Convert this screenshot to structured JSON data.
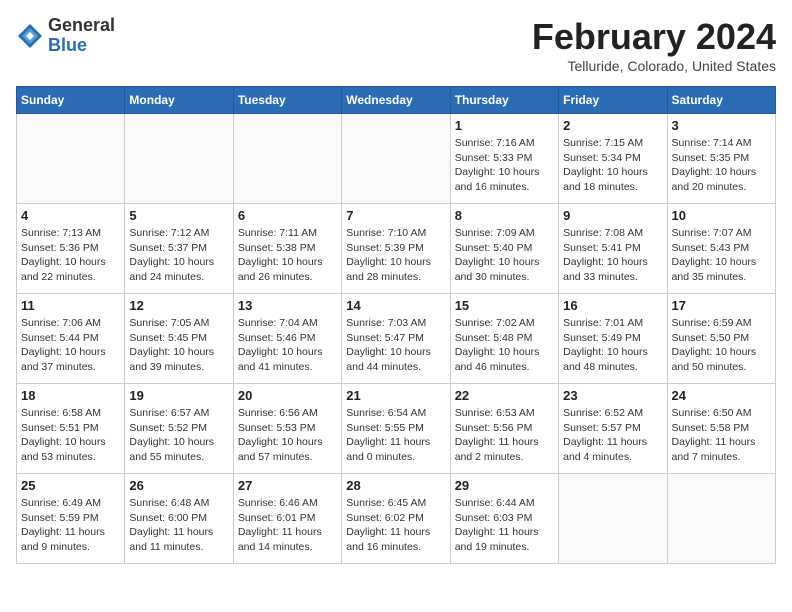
{
  "header": {
    "logo_general": "General",
    "logo_blue": "Blue",
    "title": "February 2024",
    "subtitle": "Telluride, Colorado, United States"
  },
  "days_of_week": [
    "Sunday",
    "Monday",
    "Tuesday",
    "Wednesday",
    "Thursday",
    "Friday",
    "Saturday"
  ],
  "weeks": [
    [
      {
        "day": "",
        "info": ""
      },
      {
        "day": "",
        "info": ""
      },
      {
        "day": "",
        "info": ""
      },
      {
        "day": "",
        "info": ""
      },
      {
        "day": "1",
        "info": "Sunrise: 7:16 AM\nSunset: 5:33 PM\nDaylight: 10 hours\nand 16 minutes."
      },
      {
        "day": "2",
        "info": "Sunrise: 7:15 AM\nSunset: 5:34 PM\nDaylight: 10 hours\nand 18 minutes."
      },
      {
        "day": "3",
        "info": "Sunrise: 7:14 AM\nSunset: 5:35 PM\nDaylight: 10 hours\nand 20 minutes."
      }
    ],
    [
      {
        "day": "4",
        "info": "Sunrise: 7:13 AM\nSunset: 5:36 PM\nDaylight: 10 hours\nand 22 minutes."
      },
      {
        "day": "5",
        "info": "Sunrise: 7:12 AM\nSunset: 5:37 PM\nDaylight: 10 hours\nand 24 minutes."
      },
      {
        "day": "6",
        "info": "Sunrise: 7:11 AM\nSunset: 5:38 PM\nDaylight: 10 hours\nand 26 minutes."
      },
      {
        "day": "7",
        "info": "Sunrise: 7:10 AM\nSunset: 5:39 PM\nDaylight: 10 hours\nand 28 minutes."
      },
      {
        "day": "8",
        "info": "Sunrise: 7:09 AM\nSunset: 5:40 PM\nDaylight: 10 hours\nand 30 minutes."
      },
      {
        "day": "9",
        "info": "Sunrise: 7:08 AM\nSunset: 5:41 PM\nDaylight: 10 hours\nand 33 minutes."
      },
      {
        "day": "10",
        "info": "Sunrise: 7:07 AM\nSunset: 5:43 PM\nDaylight: 10 hours\nand 35 minutes."
      }
    ],
    [
      {
        "day": "11",
        "info": "Sunrise: 7:06 AM\nSunset: 5:44 PM\nDaylight: 10 hours\nand 37 minutes."
      },
      {
        "day": "12",
        "info": "Sunrise: 7:05 AM\nSunset: 5:45 PM\nDaylight: 10 hours\nand 39 minutes."
      },
      {
        "day": "13",
        "info": "Sunrise: 7:04 AM\nSunset: 5:46 PM\nDaylight: 10 hours\nand 41 minutes."
      },
      {
        "day": "14",
        "info": "Sunrise: 7:03 AM\nSunset: 5:47 PM\nDaylight: 10 hours\nand 44 minutes."
      },
      {
        "day": "15",
        "info": "Sunrise: 7:02 AM\nSunset: 5:48 PM\nDaylight: 10 hours\nand 46 minutes."
      },
      {
        "day": "16",
        "info": "Sunrise: 7:01 AM\nSunset: 5:49 PM\nDaylight: 10 hours\nand 48 minutes."
      },
      {
        "day": "17",
        "info": "Sunrise: 6:59 AM\nSunset: 5:50 PM\nDaylight: 10 hours\nand 50 minutes."
      }
    ],
    [
      {
        "day": "18",
        "info": "Sunrise: 6:58 AM\nSunset: 5:51 PM\nDaylight: 10 hours\nand 53 minutes."
      },
      {
        "day": "19",
        "info": "Sunrise: 6:57 AM\nSunset: 5:52 PM\nDaylight: 10 hours\nand 55 minutes."
      },
      {
        "day": "20",
        "info": "Sunrise: 6:56 AM\nSunset: 5:53 PM\nDaylight: 10 hours\nand 57 minutes."
      },
      {
        "day": "21",
        "info": "Sunrise: 6:54 AM\nSunset: 5:55 PM\nDaylight: 11 hours\nand 0 minutes."
      },
      {
        "day": "22",
        "info": "Sunrise: 6:53 AM\nSunset: 5:56 PM\nDaylight: 11 hours\nand 2 minutes."
      },
      {
        "day": "23",
        "info": "Sunrise: 6:52 AM\nSunset: 5:57 PM\nDaylight: 11 hours\nand 4 minutes."
      },
      {
        "day": "24",
        "info": "Sunrise: 6:50 AM\nSunset: 5:58 PM\nDaylight: 11 hours\nand 7 minutes."
      }
    ],
    [
      {
        "day": "25",
        "info": "Sunrise: 6:49 AM\nSunset: 5:59 PM\nDaylight: 11 hours\nand 9 minutes."
      },
      {
        "day": "26",
        "info": "Sunrise: 6:48 AM\nSunset: 6:00 PM\nDaylight: 11 hours\nand 11 minutes."
      },
      {
        "day": "27",
        "info": "Sunrise: 6:46 AM\nSunset: 6:01 PM\nDaylight: 11 hours\nand 14 minutes."
      },
      {
        "day": "28",
        "info": "Sunrise: 6:45 AM\nSunset: 6:02 PM\nDaylight: 11 hours\nand 16 minutes."
      },
      {
        "day": "29",
        "info": "Sunrise: 6:44 AM\nSunset: 6:03 PM\nDaylight: 11 hours\nand 19 minutes."
      },
      {
        "day": "",
        "info": ""
      },
      {
        "day": "",
        "info": ""
      }
    ]
  ]
}
